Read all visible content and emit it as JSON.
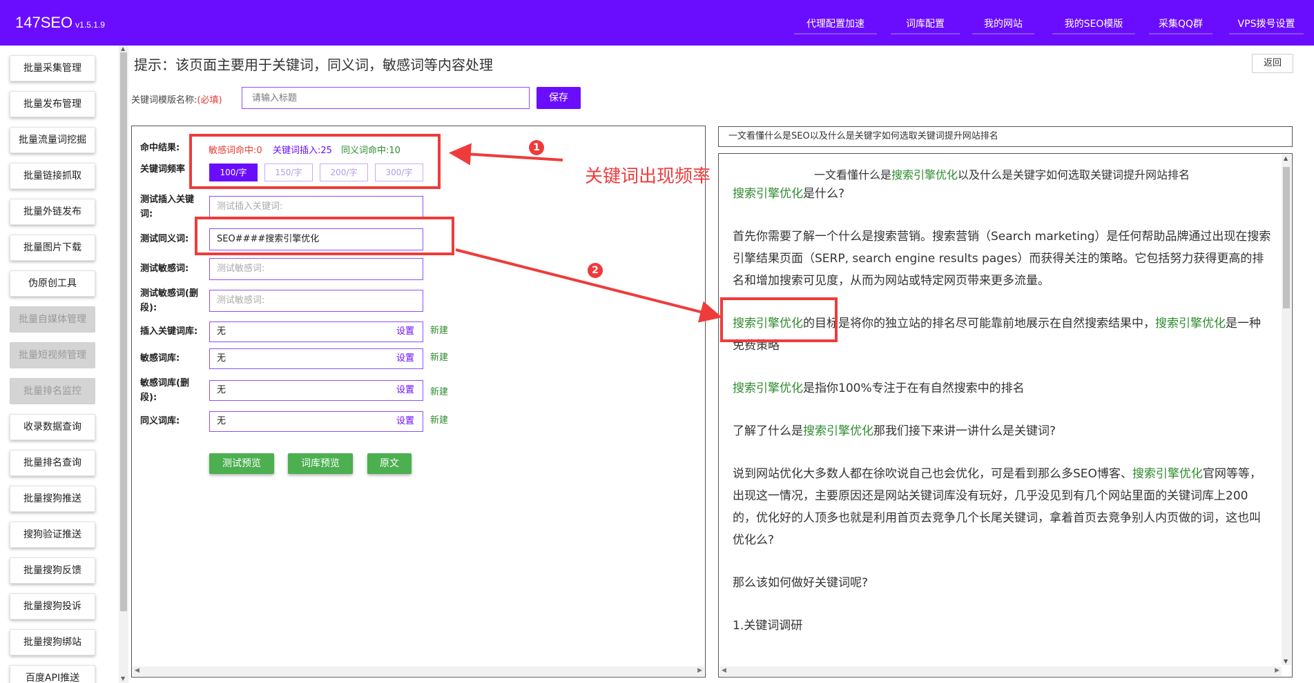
{
  "app": {
    "name": "147SEO",
    "version": "v1.5.1.9"
  },
  "top_nav": [
    "代理配置加速",
    "词库配置",
    "我的网站",
    "我的SEO模版",
    "采集QQ群",
    "VPS拨号设置"
  ],
  "sidebar": {
    "items": [
      {
        "label": "批量采集管理",
        "enabled": true
      },
      {
        "label": "批量发布管理",
        "enabled": true
      },
      {
        "label": "批量流量词挖掘",
        "enabled": true
      },
      {
        "label": "批量链接抓取",
        "enabled": true
      },
      {
        "label": "批量外链发布",
        "enabled": true
      },
      {
        "label": "批量图片下载",
        "enabled": true
      },
      {
        "label": "伪原创工具",
        "enabled": true
      },
      {
        "label": "批量自媒体管理",
        "enabled": false
      },
      {
        "label": "批量短视频管理",
        "enabled": false
      },
      {
        "label": "批量排名监控",
        "enabled": false
      },
      {
        "label": "收录数据查询",
        "enabled": true
      },
      {
        "label": "批量排名查询",
        "enabled": true
      },
      {
        "label": "批量搜狗推送",
        "enabled": true
      },
      {
        "label": "搜狗验证推送",
        "enabled": true
      },
      {
        "label": "批量搜狗反馈",
        "enabled": true
      },
      {
        "label": "批量搜狗投诉",
        "enabled": true
      },
      {
        "label": "批量搜狗绑站",
        "enabled": true
      },
      {
        "label": "百度API推送",
        "enabled": true
      }
    ]
  },
  "page": {
    "tip": "提示：该页面主要用于关键词，同义词，敏感词等内容处理",
    "back_label": "返回",
    "template_name_label": "关键词模版名称:",
    "required_label": "(必填)",
    "template_name_placeholder": "请输入标题",
    "save_label": "保存"
  },
  "form": {
    "hit_label": "命中结果:",
    "hit_sensitive": "敏感词命中:0",
    "hit_keyword": "关键词插入:25",
    "hit_synonym": "同义词命中:10",
    "freq_label": "关键词频率",
    "freq_options": [
      "100/字",
      "150/字",
      "200/字",
      "300/字"
    ],
    "freq_selected": "100/字",
    "test_insert_label": "测试插入关键词:",
    "test_insert_placeholder": "测试插入关键词:",
    "test_synonym_label": "测试同义词:",
    "test_synonym_value": "SEO####搜索引擎优化",
    "test_sensitive_label": "测试敏感词:",
    "test_sensitive_placeholder": "测试敏感词:",
    "test_sensitive_del_label": "测试敏感词(删段):",
    "test_sensitive_del_placeholder": "测试敏感词:",
    "insert_lib_label": "插入关键词库:",
    "sensitive_lib_label": "敏感词库:",
    "sensitive_del_lib_label": "敏感词库(删段):",
    "synonym_lib_label": "同义词库:",
    "lib_value": "无",
    "set_label": "设置",
    "new_label": "新建",
    "btn_test_preview": "测试预览",
    "btn_lib_preview": "词库预览",
    "btn_original": "原文"
  },
  "annotations": {
    "badge1": "1",
    "badge2": "2",
    "callout": "关键词出现频率",
    "color": "#ef3b3b"
  },
  "article": {
    "title_box": "一文看懂什么是SEO以及什么是关键字如何选取关键词提升网站排名",
    "title_pre": "一文看懂什么是",
    "title_hl": "搜索引擎优化",
    "title_post": "以及什么是关键字如何选取关键词提升网站排名",
    "p1_hl": "搜索引擎优化",
    "p1_post": "是什么?",
    "p2": "首先你需要了解一个什么是搜索营销。搜索营销（Search marketing）是任何帮助品牌通过出现在搜索引擎结果页面（SERP, search engine results pages）而获得关注的策略。它包括努力获得更高的排名和增加搜索可见度，从而为网站或特定网页带来更多流量。",
    "p3_hl1": "搜索引擎优化",
    "p3_mid": "的目标是将你的独立站的排名尽可能靠前地展示在自然搜索结果中，",
    "p3_hl2": "搜索引擎优化",
    "p3_post": "是一种免费策略",
    "p4_hl": "搜索引擎优化",
    "p4_post": "是指你100%专注于在有自然搜索中的排名",
    "p5_pre": "了解了什么是",
    "p5_hl": "搜索引擎优化",
    "p5_post": "那我们接下来讲一讲什么是关键词?",
    "p6_pre": "说到网站优化大多数人都在徐吹说自己也会优化，可是看到那么多SEO博客、",
    "p6_hl": "搜索引擎优化",
    "p6_post": "官网等等，出现这一情况，主要原因还是网站关键词库没有玩好，几乎没见到有几个网站里面的关键词库上200的，优化好的人顶多也就是利用首页去竞争几个长尾关键词，拿着首页去竞争别人内页做的词，这也叫优化么?",
    "p7": "那么该如何做好关键词呢?",
    "p8": "1.关键词调研"
  },
  "colors": {
    "brand": "#6a0dff",
    "green": "#4caf50",
    "red": "#ef3b3b"
  }
}
